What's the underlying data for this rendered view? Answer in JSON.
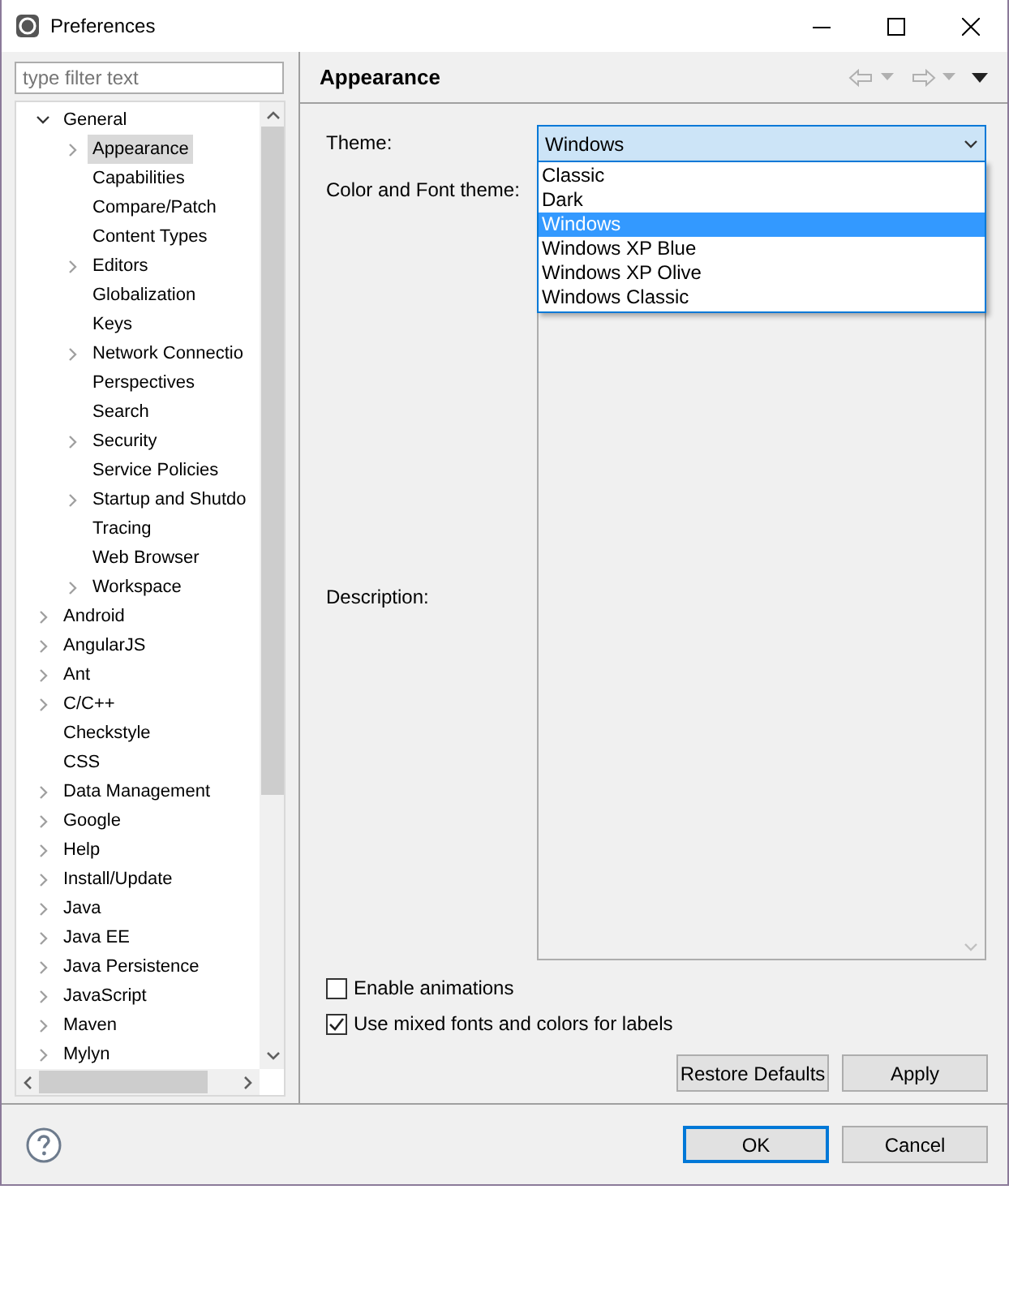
{
  "window": {
    "title": "Preferences"
  },
  "filter": {
    "placeholder": "type filter text"
  },
  "tree": [
    {
      "label": "General",
      "expandable": true,
      "expanded": true,
      "selected": false,
      "children": [
        {
          "label": "Appearance",
          "expandable": true,
          "expanded": false,
          "selected": true
        },
        {
          "label": "Capabilities",
          "expandable": false,
          "selected": false
        },
        {
          "label": "Compare/Patch",
          "expandable": false,
          "selected": false
        },
        {
          "label": "Content Types",
          "expandable": false,
          "selected": false
        },
        {
          "label": "Editors",
          "expandable": true,
          "expanded": false,
          "selected": false
        },
        {
          "label": "Globalization",
          "expandable": false,
          "selected": false
        },
        {
          "label": "Keys",
          "expandable": false,
          "selected": false
        },
        {
          "label": "Network Connectio",
          "expandable": true,
          "expanded": false,
          "selected": false
        },
        {
          "label": "Perspectives",
          "expandable": false,
          "selected": false
        },
        {
          "label": "Search",
          "expandable": false,
          "selected": false
        },
        {
          "label": "Security",
          "expandable": true,
          "expanded": false,
          "selected": false
        },
        {
          "label": "Service Policies",
          "expandable": false,
          "selected": false
        },
        {
          "label": "Startup and Shutdo",
          "expandable": true,
          "expanded": false,
          "selected": false
        },
        {
          "label": "Tracing",
          "expandable": false,
          "selected": false
        },
        {
          "label": "Web Browser",
          "expandable": false,
          "selected": false
        },
        {
          "label": "Workspace",
          "expandable": true,
          "expanded": false,
          "selected": false
        }
      ]
    },
    {
      "label": "Android",
      "expandable": true,
      "expanded": false,
      "selected": false
    },
    {
      "label": "AngularJS",
      "expandable": true,
      "expanded": false,
      "selected": false
    },
    {
      "label": "Ant",
      "expandable": true,
      "expanded": false,
      "selected": false
    },
    {
      "label": "C/C++",
      "expandable": true,
      "expanded": false,
      "selected": false
    },
    {
      "label": "Checkstyle",
      "expandable": false,
      "selected": false
    },
    {
      "label": "CSS",
      "expandable": false,
      "selected": false
    },
    {
      "label": "Data Management",
      "expandable": true,
      "expanded": false,
      "selected": false
    },
    {
      "label": "Google",
      "expandable": true,
      "expanded": false,
      "selected": false
    },
    {
      "label": "Help",
      "expandable": true,
      "expanded": false,
      "selected": false
    },
    {
      "label": "Install/Update",
      "expandable": true,
      "expanded": false,
      "selected": false
    },
    {
      "label": "Java",
      "expandable": true,
      "expanded": false,
      "selected": false
    },
    {
      "label": "Java EE",
      "expandable": true,
      "expanded": false,
      "selected": false
    },
    {
      "label": "Java Persistence",
      "expandable": true,
      "expanded": false,
      "selected": false
    },
    {
      "label": "JavaScript",
      "expandable": true,
      "expanded": false,
      "selected": false
    },
    {
      "label": "Maven",
      "expandable": true,
      "expanded": false,
      "selected": false
    },
    {
      "label": "Mylyn",
      "expandable": true,
      "expanded": false,
      "selected": false
    }
  ],
  "page": {
    "title": "Appearance",
    "theme_label": "Theme:",
    "theme_value": "Windows",
    "theme_options": [
      {
        "label": "Classic",
        "selected": false
      },
      {
        "label": "Dark",
        "selected": false
      },
      {
        "label": "Windows",
        "selected": true
      },
      {
        "label": "Windows XP Blue",
        "selected": false
      },
      {
        "label": "Windows XP Olive",
        "selected": false
      },
      {
        "label": "Windows Classic",
        "selected": false
      }
    ],
    "color_font_label": "Color and Font theme:",
    "description_label": "Description:",
    "checkboxes": [
      {
        "label": "Enable animations",
        "checked": false
      },
      {
        "label": "Use mixed fonts and colors for labels",
        "checked": true
      }
    ],
    "buttons": [
      "Restore Defaults",
      "Apply"
    ]
  },
  "dialog_buttons": [
    {
      "label": "OK",
      "default": true
    },
    {
      "label": "Cancel",
      "default": false
    }
  ]
}
